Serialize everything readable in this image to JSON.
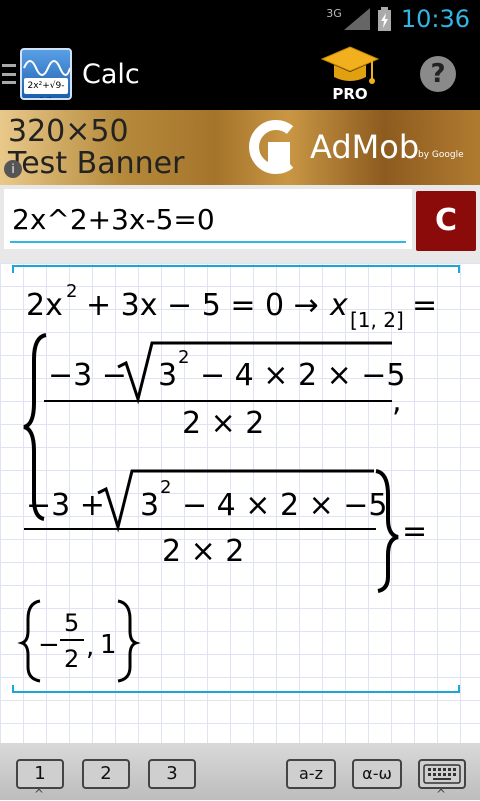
{
  "status_bar": {
    "network": "3G",
    "time": "10:36",
    "accent_color": "#33b5e5"
  },
  "action_bar": {
    "app_icon_formula": "2x²+√9-3/2",
    "title": "Calc",
    "pro_label": "PRO",
    "help_glyph": "?"
  },
  "ad_banner": {
    "line1": "320×50",
    "line2": "Test Banner",
    "info_glyph": "i",
    "brand": "AdMob",
    "by": "by Google"
  },
  "input": {
    "value": "2x^2+3x-5=0",
    "clear_label": "C"
  },
  "result": {
    "line1": {
      "a": "2x",
      "exp": "2",
      "rest": "+ 3x − 5 = 0 →",
      "var": "x",
      "sub": "[1, 2]",
      "eq": "="
    },
    "root1": {
      "num_left": "−3 −",
      "rad_base": "3",
      "rad_exp": "2",
      "rad_rest": "− 4 × 2 × −5",
      "den": "2 × 2",
      "sep": ","
    },
    "root2": {
      "num_left": "−3 +",
      "rad_base": "3",
      "rad_exp": "2",
      "rad_rest": "− 4 × 2 × −5",
      "den": "2 × 2",
      "eq": "="
    },
    "answer": {
      "neg": "−",
      "num": "5",
      "den": "2",
      "sep": ",",
      "second": "1"
    }
  },
  "keyboard": {
    "tab1": "1",
    "tab2": "2",
    "tab3": "3",
    "tab_alpha": "a-z",
    "tab_greek": "α-ω",
    "caret": "^"
  }
}
